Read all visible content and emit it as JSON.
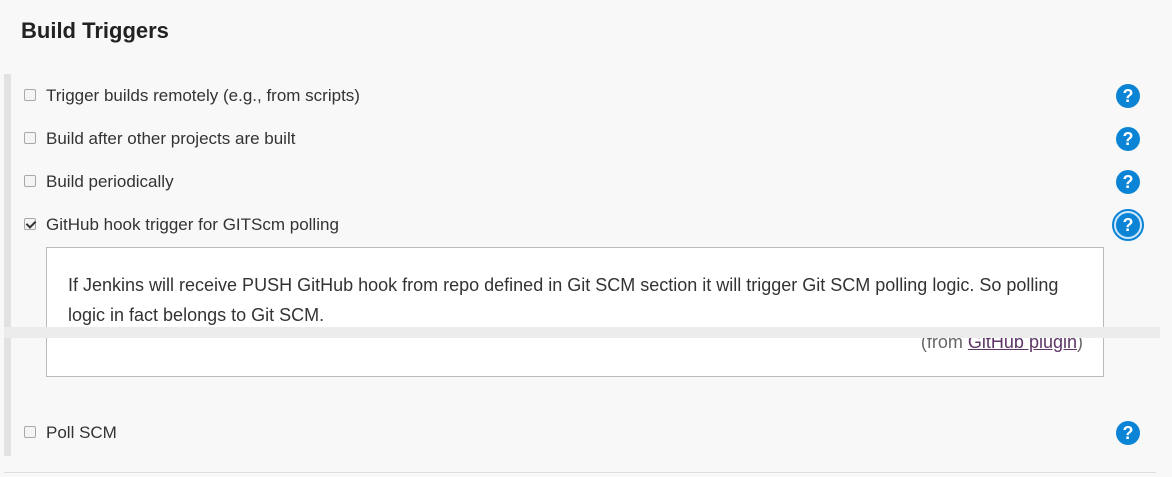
{
  "section": {
    "title": "Build Triggers"
  },
  "triggers": [
    {
      "label": "Trigger builds remotely (e.g., from scripts)",
      "checked": false
    },
    {
      "label": "Build after other projects are built",
      "checked": false
    },
    {
      "label": "Build periodically",
      "checked": false
    },
    {
      "label": "GitHub hook trigger for GITScm polling",
      "checked": true
    },
    {
      "label": "Poll SCM",
      "checked": false
    }
  ],
  "help_icon": {
    "glyph": "?",
    "icon": "question-circle-icon",
    "color": "#0b84d6"
  },
  "help_panel": {
    "text": "If Jenkins will receive PUSH GitHub hook from repo defined in Git SCM section it will trigger Git SCM polling logic. So polling logic in fact belongs to Git SCM.",
    "source_prefix": "(from ",
    "source_link": "GitHub plugin",
    "source_suffix": ")"
  }
}
